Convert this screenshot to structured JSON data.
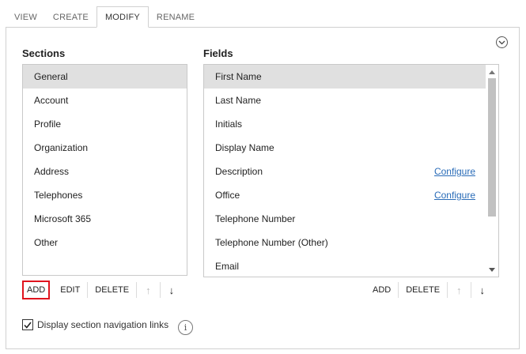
{
  "tabs": [
    {
      "label": "VIEW"
    },
    {
      "label": "CREATE"
    },
    {
      "label": "MODIFY",
      "active": true
    },
    {
      "label": "RENAME"
    }
  ],
  "sections": {
    "heading": "Sections",
    "items": [
      "General",
      "Account",
      "Profile",
      "Organization",
      "Address",
      "Telephones",
      "Microsoft 365",
      "Other"
    ],
    "selected": "General",
    "toolbar": {
      "add": "ADD",
      "edit": "EDIT",
      "delete": "DELETE",
      "up": "↑",
      "down": "↓"
    }
  },
  "fields": {
    "heading": "Fields",
    "items": [
      {
        "label": "First Name",
        "selected": true
      },
      {
        "label": "Last Name"
      },
      {
        "label": "Initials"
      },
      {
        "label": "Display Name"
      },
      {
        "label": "Description",
        "link": "Configure"
      },
      {
        "label": "Office",
        "link": "Configure"
      },
      {
        "label": "Telephone Number"
      },
      {
        "label": "Telephone Number (Other)"
      },
      {
        "label": "Email"
      }
    ],
    "toolbar": {
      "add": "ADD",
      "delete": "DELETE",
      "up": "↑",
      "down": "↓"
    }
  },
  "options": {
    "show_nav_links_label": "Display section navigation links",
    "show_nav_links_checked": true
  },
  "colors": {
    "link": "#2a6cb8",
    "highlight_border": "#e0141e",
    "selected_bg": "#e0e0e0"
  }
}
